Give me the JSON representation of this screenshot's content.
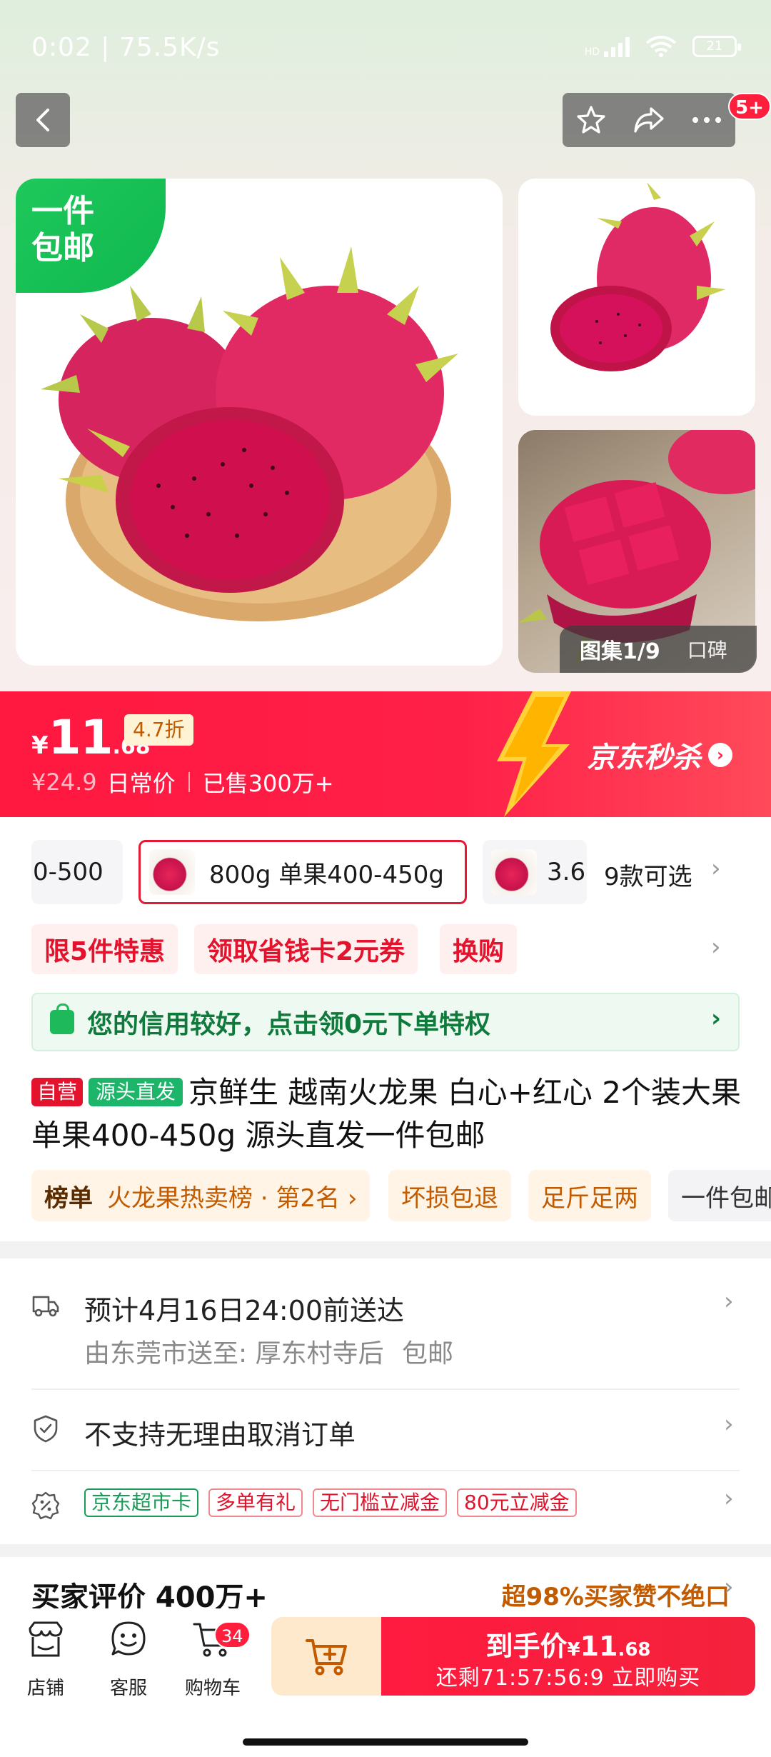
{
  "status_bar": {
    "time": "0:02",
    "speed": "75.5K/s",
    "hd": "HD",
    "battery": "21"
  },
  "header": {
    "badge": "5+"
  },
  "hero": {
    "promo_corner": [
      "一件",
      "包邮"
    ],
    "gallery_label": "图集1/9",
    "review_label": "口碑"
  },
  "price": {
    "currency": "¥",
    "integer": "11",
    "decimal": ".68",
    "discount": "4.7折",
    "original": "¥24.9",
    "original_label": "日常价",
    "sold": "已售300万+",
    "seckill_label": "京东秒杀"
  },
  "specs": {
    "option1": "0-500",
    "option2": "800g 单果400-450g",
    "option3": "3.6",
    "more_label": "9款可选"
  },
  "promotions": [
    "限5件特惠",
    "领取省钱卡2元券",
    "换购"
  ],
  "credit_banner": "您的信用较好，点击领0元下单特权",
  "title": {
    "badge_self": "自营",
    "badge_source": "源头直发",
    "text": "京鲜生 越南火龙果 白心+红心 2个装大果单果400-450g 源头直发一件包邮"
  },
  "rank_tags": {
    "rank_label": "榜单",
    "rank_text": "火龙果热卖榜 · 第2名 ›",
    "tag2": "坏损包退",
    "tag3": "足斤足两",
    "tag4": "一件包邮"
  },
  "delivery": {
    "eta": "预计4月16日24:00前送达",
    "route": "由东莞市送至: 厚东村寺后",
    "shipping": "包邮"
  },
  "cancel_policy": "不支持无理由取消订单",
  "coupons": [
    "京东超市卡",
    "多单有礼",
    "无门槛立减金",
    "80元立减金"
  ],
  "reviews": {
    "title": "买家评价 400万+",
    "praise": "超98%买家赞不绝口"
  },
  "bottom_nav": {
    "shop": "店铺",
    "service": "客服",
    "cart": "购物车",
    "cart_count": "34"
  },
  "buy_button": {
    "label": "到手价",
    "currency": "¥",
    "price_int": "11",
    "price_dec": ".68",
    "countdown": "还剩71:57:56:9 立即购买"
  },
  "colors": {
    "accent_red": "#ff1840",
    "green": "#1eb95b",
    "orange": "#c25b00"
  }
}
